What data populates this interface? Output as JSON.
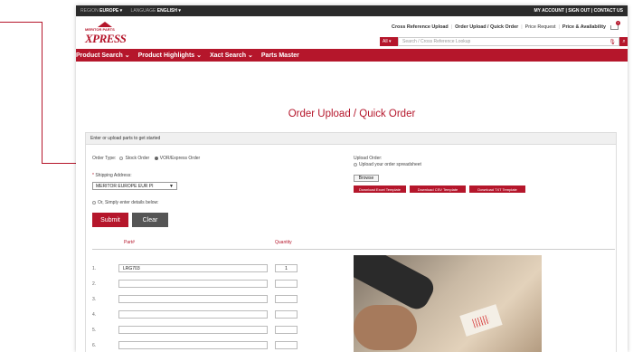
{
  "topbar": {
    "region_label": "REGION",
    "region_value": "EUROPE",
    "language_label": "LANGUAGE",
    "language_value": "ENGLISH",
    "right_links": "MY ACCOUNT | SIGN OUT | CONTACT US"
  },
  "logo": {
    "line1": "MERITOR PARTS",
    "line2": "XPRESS"
  },
  "header_links": [
    "Cross Reference Upload",
    "Order Upload / Quick Order",
    "Price Request",
    "Price & Availability"
  ],
  "search": {
    "scope": "All",
    "placeholder": "Search / Cross Reference Lookup"
  },
  "nav": [
    "Product Search",
    "Product Highlights",
    "Xact Search",
    "Parts Master"
  ],
  "page_title": "Order Upload / Quick Order",
  "panel": {
    "heading": "Enter or upload parts to get started",
    "order_type_label": "Order Type:",
    "order_type_options": [
      "Stock Order",
      "VOR/Express Order"
    ],
    "shipping_label": "Shipping Address:",
    "shipping_value": "MERITOR EUROPE EUR PI",
    "simple_entry_label": "Or, Simply enter details below:",
    "upload_label": "Upload Order:",
    "upload_option": "Upload your order spreadsheet",
    "browse_label": "Browse",
    "templates": [
      "Download Excel Template",
      "Download CSV Template",
      "Download TXT Template"
    ],
    "submit_label": "Submit",
    "clear_label": "Clear",
    "col_part": "Part#",
    "col_qty": "Quantity",
    "rows": [
      {
        "num": "1.",
        "part": "LRG703",
        "qty": "1"
      },
      {
        "num": "2.",
        "part": "",
        "qty": ""
      },
      {
        "num": "3.",
        "part": "",
        "qty": ""
      },
      {
        "num": "4.",
        "part": "",
        "qty": ""
      },
      {
        "num": "5.",
        "part": "",
        "qty": ""
      },
      {
        "num": "6.",
        "part": "",
        "qty": ""
      }
    ]
  }
}
